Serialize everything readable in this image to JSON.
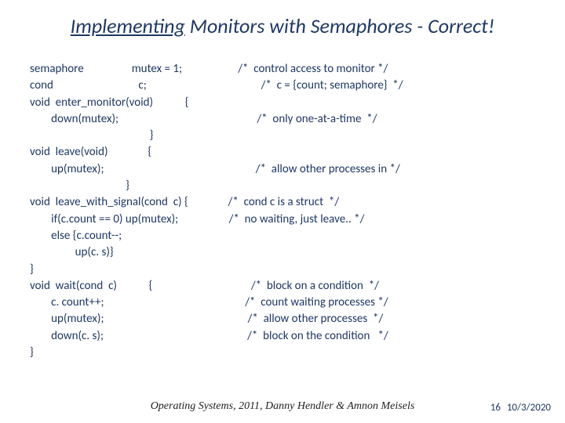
{
  "title_prefix": "Implementing",
  "title_rest": " Monitors with Semaphores - Correct!",
  "code_text": "semaphore                  mutex = 1;                     /*  control access to monitor */\ncond                                c;                                           /*  c = {count; semaphore}  */\nvoid  enter_monitor(void)            {\n        down(mutex);                                                    /*  only one-at-a-time  */\n                                             }\nvoid  leave(void)               {\n        up(mutex);                                                         /*  allow other processes in */\n                                    }\nvoid  leave_with_signal(cond  c) {               /*  cond c is a struct  */\n        if(c.count == 0) up(mutex);                   /*  no waiting, just leave.. */\n        else {c.count--;\n                 up(c. s)}\n}\nvoid  wait(cond  c)            {                                     /*  block on a condition  */\n        c. count++;                                                     /*  count waiting processes */\n        up(mutex);                                                      /*  allow other processes  */\n        down(c. s);                                                      /*  block on the condition   */\n}",
  "footer_credit": "Operating Systems, 2011, Danny Hendler & Amnon Meisels",
  "page_num": "16",
  "date": "10/3/2020"
}
